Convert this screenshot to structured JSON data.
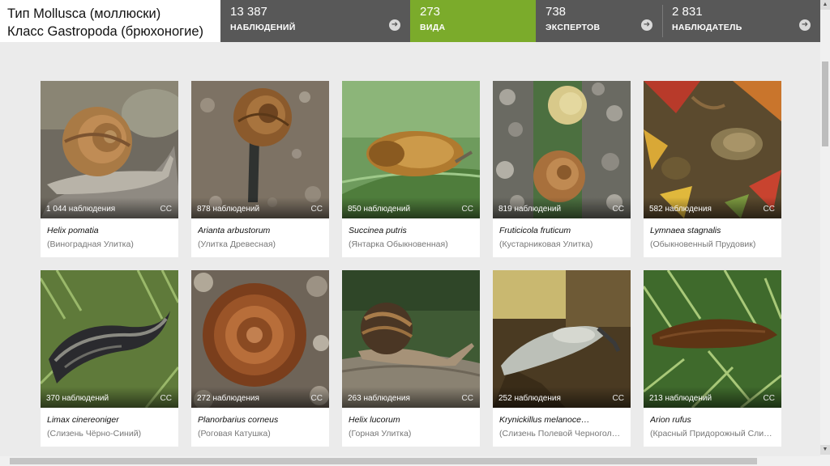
{
  "taxon": {
    "line1": "Тип Mollusca (моллюски)",
    "line2": "Класс Gastropoda (брюхоногие)"
  },
  "stats": [
    {
      "value": "13 387",
      "label": "НАБЛЮДЕНИЙ",
      "active": false
    },
    {
      "value": "273",
      "label": "ВИДА",
      "active": true
    },
    {
      "value": "738",
      "label": "ЭКСПЕРТОВ",
      "active": false
    },
    {
      "value": "2 831",
      "label": "НАБЛЮДАТЕЛЬ",
      "active": false
    }
  ],
  "arrow_glyph": "➜",
  "cc_label": "CC",
  "colors": {
    "accent": "#7bab2b",
    "header_dark": "#585858",
    "background": "#ebebeb"
  },
  "species": [
    {
      "observations": "1 044 наблюдения",
      "scientific": "Helix pomatia",
      "common": "(Виноградная Улитка)",
      "photo": "snail-on-soil"
    },
    {
      "observations": "878 наблюдений",
      "scientific": "Arianta arbustorum",
      "common": "(Улитка Древесная)",
      "photo": "snail-on-gravel"
    },
    {
      "observations": "850 наблюдений",
      "scientific": "Succinea putris",
      "common": "(Янтарка Обыкновенная)",
      "photo": "amber-snail-on-leaf"
    },
    {
      "observations": "819 наблюдений",
      "scientific": "Fruticicola fruticum",
      "common": "(Кустарниковая Улитка)",
      "photo": "two-snails-on-pebbles"
    },
    {
      "observations": "582 наблюдения",
      "scientific": "Lymnaea stagnalis",
      "common": "(Обыкновенный Прудовик)",
      "photo": "pond-snail-in-leaves"
    },
    {
      "observations": "370 наблюдений",
      "scientific": "Limax cinereoniger",
      "common": "(Слизень Чёрно-Синий)",
      "photo": "black-slug-on-grass"
    },
    {
      "observations": "272 наблюдения",
      "scientific": "Planorbarius corneus",
      "common": "(Роговая Катушка)",
      "photo": "ramshorn-shell"
    },
    {
      "observations": "263 наблюдения",
      "scientific": "Helix lucorum",
      "common": "(Горная Улитка)",
      "photo": "snail-on-log"
    },
    {
      "observations": "252 наблюдения",
      "scientific": "Krynickillus melanoce…",
      "common": "(Слизень Полевой Черногол…",
      "photo": "pale-slug"
    },
    {
      "observations": "213 наблюдений",
      "scientific": "Arion rufus",
      "common": "(Красный Придорожный Сли…",
      "photo": "brown-slug-on-grass"
    }
  ]
}
